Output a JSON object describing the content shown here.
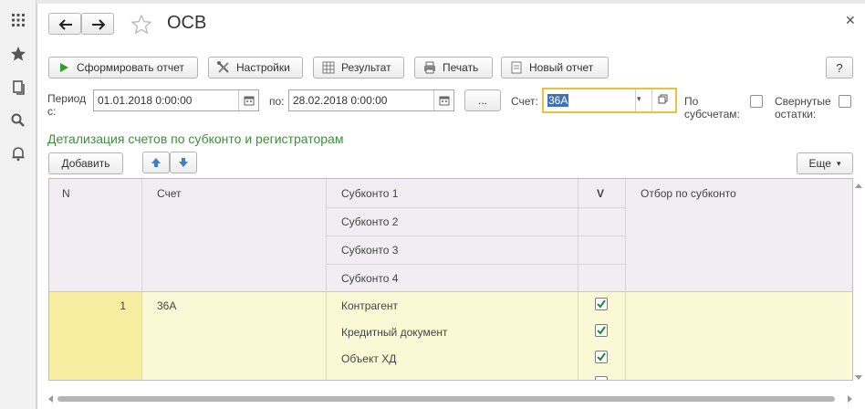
{
  "window": {
    "title": "ОСВ"
  },
  "toolbar": {
    "generate_label": "Сформировать отчет",
    "settings_label": "Настройки",
    "result_label": "Результат",
    "print_label": "Печать",
    "new_report_label": "Новый отчет",
    "help_label": "?"
  },
  "period": {
    "label_line1": "Период",
    "label_line2": "с:",
    "from_value": "01.01.2018  0:00:00",
    "to_label": "по:",
    "to_value": "28.02.2018  0:00:00",
    "ellipsis_label": "..."
  },
  "account": {
    "label": "Счет:",
    "value": "36А"
  },
  "options": {
    "by_subaccounts_line1": "По",
    "by_subaccounts_line2": "субсчетам:",
    "collapsed_line1": "Свернутые",
    "collapsed_line2": "остатки:"
  },
  "section": {
    "title": "Детализация счетов по субконто и регистраторам",
    "add_label": "Добавить",
    "more_label": "Еще"
  },
  "table": {
    "headers": {
      "n": "N",
      "account": "Счет",
      "subconto1": "Субконто 1",
      "subconto2": "Субконто 2",
      "subconto3": "Субконто 3",
      "subconto4": "Субконто 4",
      "v": "V",
      "filter": "Отбор по субконто"
    },
    "rows": [
      {
        "n": "1",
        "account": "36А",
        "sub1": "Контрагент",
        "sub2": "Кредитный документ",
        "sub3": "Объект ХД",
        "check1": true,
        "check2": true,
        "check3": true,
        "check4": false
      }
    ]
  },
  "colors": {
    "accent_green": "#3d8f3d",
    "header_bg": "#f2edf3",
    "row_bg": "#fbf8d5",
    "row_num_bg": "#f7ec9f",
    "focus_border": "#e8c23a"
  }
}
